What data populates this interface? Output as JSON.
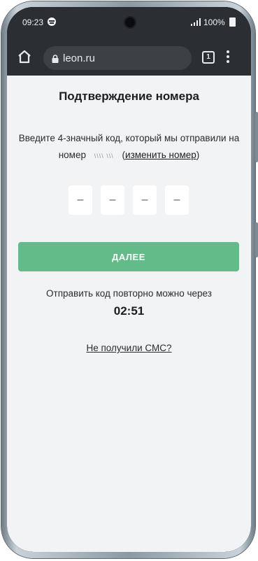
{
  "status_bar": {
    "time": "09:23",
    "battery": "100%",
    "icons": [
      "spotify-icon",
      "signal-icon",
      "battery-icon",
      "camera"
    ]
  },
  "browser": {
    "url": "leon.ru",
    "tab_count": "1",
    "icons": [
      "home-icon",
      "lock-icon",
      "tab-switcher-icon",
      "more-menu-icon"
    ]
  },
  "page": {
    "title": "Подтверждение номера",
    "instruction": "Введите 4-значный код, который мы отправили на номер",
    "phone_masked": "\\\\\\\\ \\\\\\",
    "change_open": "(",
    "change_link": "изменить номер",
    "change_close": ")",
    "code_placeholders": [
      "–",
      "–",
      "–",
      "–"
    ],
    "next_button": "ДАЛЕЕ",
    "resend_text": "Отправить код повторно можно через",
    "timer": "02:51",
    "no_sms_link": "Не получили СМС?"
  },
  "colors": {
    "accent_button": "#64bb8a",
    "page_background": "#f1f3f5",
    "browser_chrome": "#2b2f33"
  }
}
